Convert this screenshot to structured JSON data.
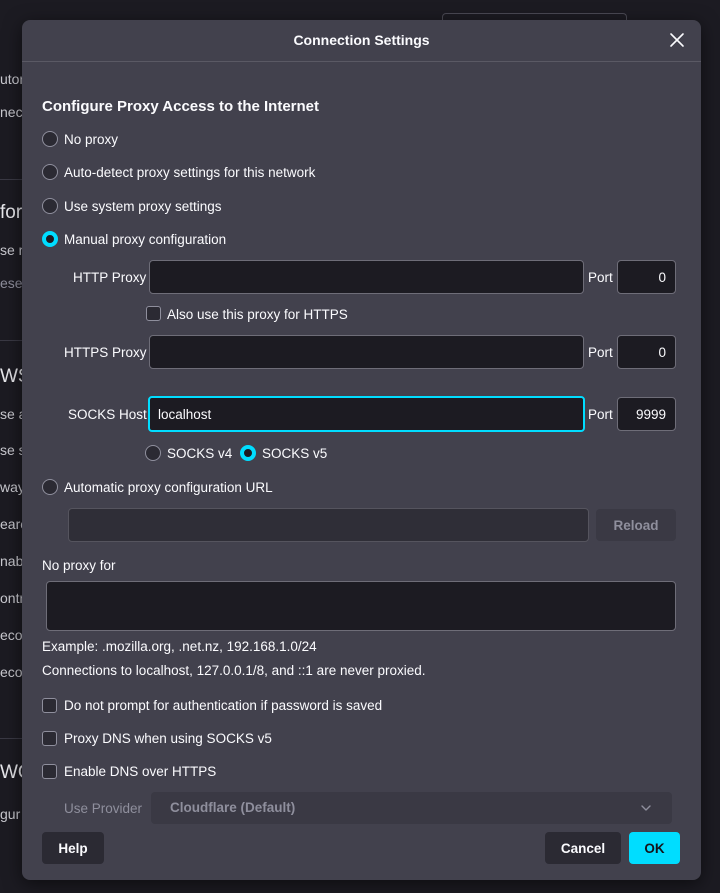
{
  "background": {
    "fragments": [
      "utor",
      "nec",
      "for",
      "se r",
      "ese",
      "WS",
      "se a",
      "se s",
      "way",
      "earc",
      "nabl",
      "ontr",
      "eco",
      "eco",
      "WO",
      "gur"
    ]
  },
  "dialog": {
    "title": "Connection Settings",
    "heading": "Configure Proxy Access to the Internet",
    "radios": {
      "no_proxy": "No proxy",
      "auto_detect": "Auto-detect proxy settings for this network",
      "system": "Use system proxy settings",
      "manual": "Manual proxy configuration",
      "auto_url": "Automatic proxy configuration URL"
    },
    "http_proxy": {
      "label": "HTTP Proxy",
      "value": "",
      "port_label": "Port",
      "port": "0"
    },
    "also_https": "Also use this proxy for HTTPS",
    "https_proxy": {
      "label": "HTTPS Proxy",
      "value": "",
      "port_label": "Port",
      "port": "0"
    },
    "socks": {
      "label": "SOCKS Host",
      "value": "localhost",
      "port_label": "Port",
      "port": "9999",
      "v4": "SOCKS v4",
      "v5": "SOCKS v5"
    },
    "auto_url_value": "",
    "reload": "Reload",
    "no_proxy_for": {
      "label": "No proxy for",
      "value": ""
    },
    "example": "Example: .mozilla.org, .net.nz, 192.168.1.0/24",
    "note": "Connections to localhost, 127.0.0.1/8, and ::1 are never proxied.",
    "checks": {
      "no_prompt": "Do not prompt for authentication if password is saved",
      "proxy_dns": "Proxy DNS when using SOCKS v5",
      "dns_https": "Enable DNS over HTTPS"
    },
    "provider": {
      "label": "Use Provider",
      "value": "Cloudflare (Default)"
    },
    "buttons": {
      "help": "Help",
      "cancel": "Cancel",
      "ok": "OK"
    }
  },
  "colors": {
    "accent": "#00ddff",
    "dialog_bg": "#42414d",
    "field_bg": "#1c1b22"
  },
  "icons": {
    "close": "close-icon",
    "dropdown": "chevron-down-icon"
  }
}
